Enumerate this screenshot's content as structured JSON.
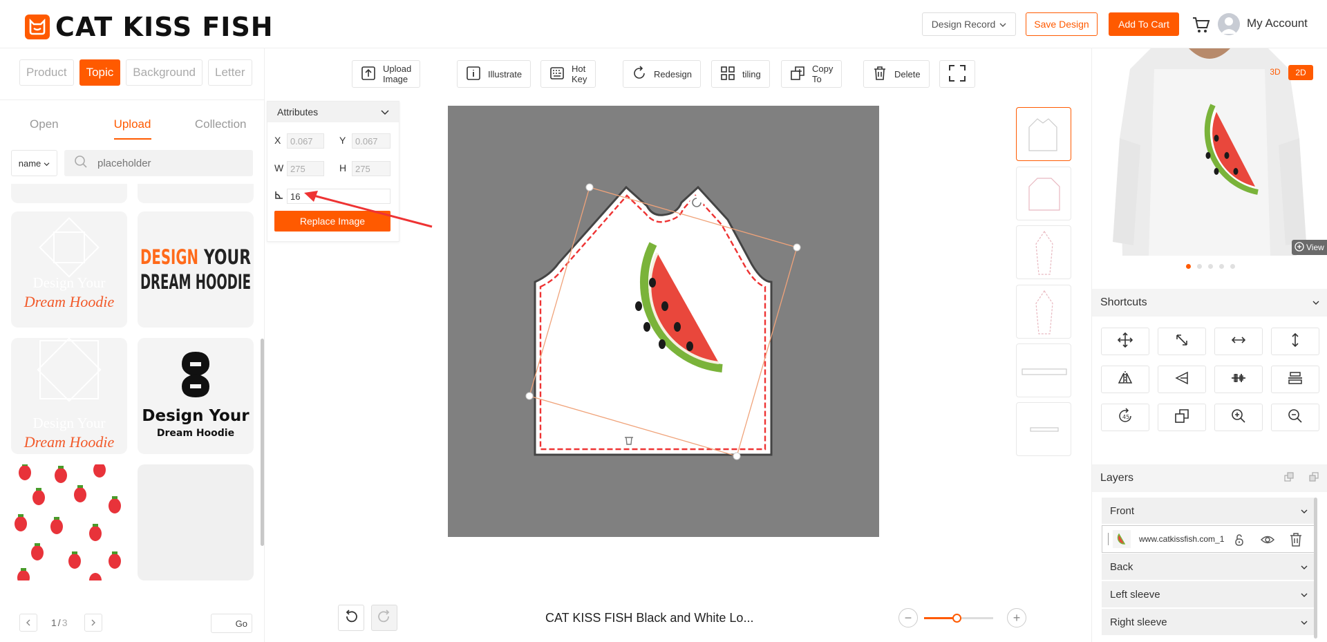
{
  "brand": {
    "name": "CAT KISS FISH",
    "accent": "#ff5a00"
  },
  "header": {
    "design_record": "Design Record",
    "save_design": "Save Design",
    "add_to_cart": "Add To Cart",
    "account": "My Account"
  },
  "left": {
    "categories": [
      "Product",
      "Topic",
      "Background",
      "Letter"
    ],
    "active_category": "Topic",
    "subtabs": [
      "Open",
      "Upload",
      "Collection"
    ],
    "active_subtab": "Upload",
    "sort": "name",
    "search_placeholder": "placeholder",
    "tiles": {
      "t1_line1": "Design Your",
      "t1_line2": "Dream Hoodie",
      "t2_line1a": "DESIGN",
      "t2_line1b": "YOUR",
      "t2_line2": "DREAM HOODIE",
      "t4_line1": "Design Your",
      "t4_line2": "Dream Hoodie"
    },
    "pager": {
      "current": "1",
      "sep": "/",
      "total": "3",
      "go": "Go"
    }
  },
  "toolbar": {
    "upload_image": "Upload Image",
    "illustrate": "Illustrate",
    "hot_key": "Hot Key",
    "redesign": "Redesign",
    "tiling": "tiling",
    "copy_to": "Copy To",
    "delete": "Delete"
  },
  "attributes": {
    "title": "Attributes",
    "x_label": "X",
    "x_value": "0.067",
    "y_label": "Y",
    "y_value": "0.067",
    "w_label": "W",
    "w_value": "275",
    "h_label": "H",
    "h_value": "275",
    "angle_value": "16",
    "replace": "Replace Image"
  },
  "bottom": {
    "product_title": "CAT KISS FISH Black and White Lo...",
    "zoom_level": 0.47
  },
  "right": {
    "mode_3d": "3D",
    "mode_2d": "2D",
    "view": "View",
    "shortcuts": "Shortcuts",
    "layers": "Layers",
    "layer_groups": [
      "Front",
      "Back",
      "Left sleeve",
      "Right sleeve"
    ],
    "layer_item": "www.catkissfish.com_1"
  }
}
